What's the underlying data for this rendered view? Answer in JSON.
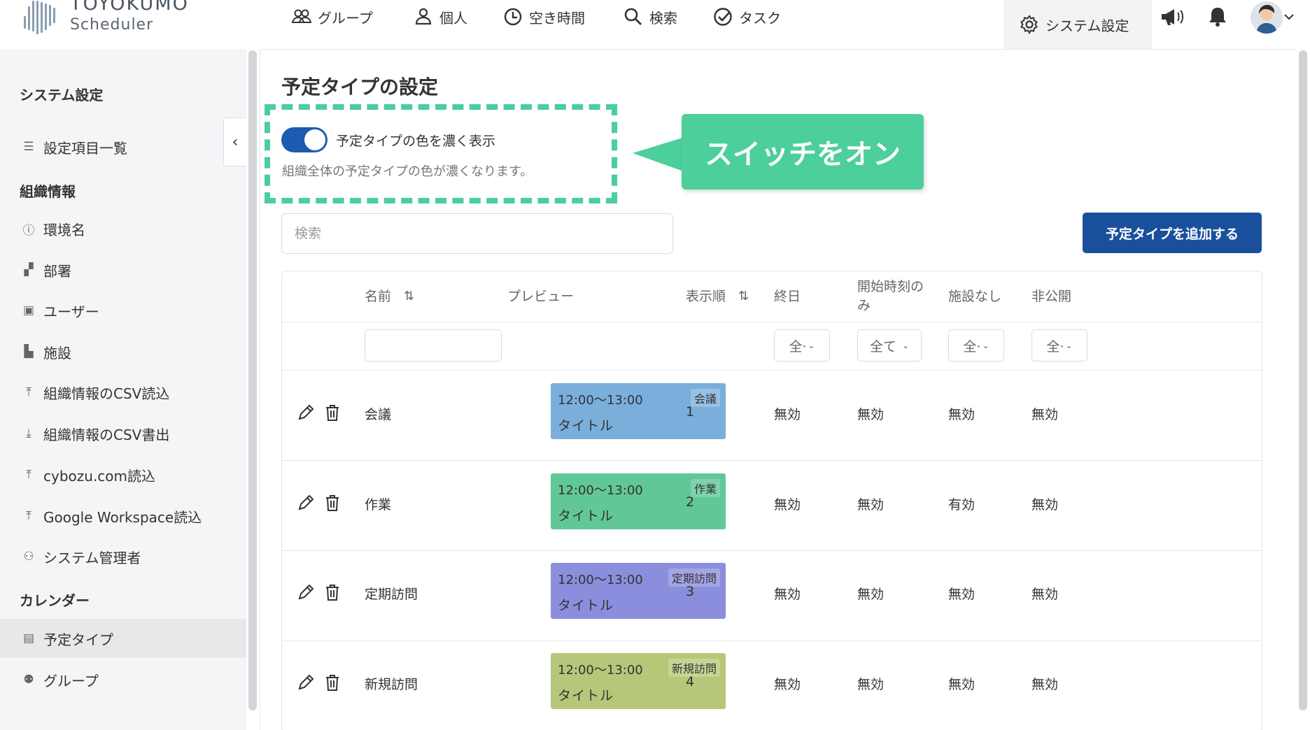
{
  "app": {
    "brand_title": "TOYOKUMO",
    "brand_sub": "Scheduler"
  },
  "nav": [
    {
      "label": "グループ",
      "icon": "group-icon"
    },
    {
      "label": "個人",
      "icon": "person-icon"
    },
    {
      "label": "空き時間",
      "icon": "clock-icon"
    },
    {
      "label": "検索",
      "icon": "search-icon"
    },
    {
      "label": "タスク",
      "icon": "task-check-icon"
    }
  ],
  "header": {
    "system_settings": "システム設定"
  },
  "sidebar": {
    "title": "システム設定",
    "items_top": [
      {
        "label": "設定項目一覧"
      }
    ],
    "section_org": "組織情報",
    "org_items": [
      {
        "label": "環境名"
      },
      {
        "label": "部署"
      },
      {
        "label": "ユーザー"
      },
      {
        "label": "施設"
      },
      {
        "label": "組織情報のCSV読込"
      },
      {
        "label": "組織情報のCSV書出"
      },
      {
        "label": "cybozu.com読込"
      },
      {
        "label": "Google Workspace読込"
      },
      {
        "label": "システム管理者"
      }
    ],
    "section_calendar": "カレンダー",
    "calendar_items": [
      {
        "label": "予定タイプ"
      },
      {
        "label": "グループ"
      }
    ]
  },
  "main": {
    "title": "予定タイプの設定",
    "toggle_label": "予定タイプの色を濃く表示",
    "toggle_on": true,
    "toggle_desc": "組織全体の予定タイプの色が濃くなります。",
    "callout": "スイッチをオン",
    "search_placeholder": "検索",
    "add_button": "予定タイプを追加する"
  },
  "table": {
    "headers": {
      "name": "名前",
      "preview": "プレビュー",
      "order": "表示順",
      "allday": "終日",
      "startonly_1": "開始時刻の",
      "startonly_2": "み",
      "nofacility": "施設なし",
      "private": "非公開",
      "sort_symbol": "⇅"
    },
    "filters": {
      "allday": "全·",
      "startonly": "全て",
      "nofacility": "全·",
      "private": "全·"
    },
    "rows": [
      {
        "name": "会議",
        "time": "12:00〜13:00",
        "ptitle": "タイトル",
        "tag": "会議",
        "color": "#7aaedb",
        "tagColor": "#98c0e4",
        "order": "1",
        "allday": "無効",
        "startonly": "無効",
        "nofacility": "無効",
        "private": "無効"
      },
      {
        "name": "作業",
        "time": "12:00〜13:00",
        "ptitle": "タイトル",
        "tag": "作業",
        "color": "#61c796",
        "tagColor": "#7fd3ab",
        "order": "2",
        "allday": "無効",
        "startonly": "無効",
        "nofacility": "有効",
        "private": "無効"
      },
      {
        "name": "定期訪問",
        "time": "12:00〜13:00",
        "ptitle": "タイトル",
        "tag": "定期訪問",
        "color": "#8a8edc",
        "tagColor": "#a3a6e4",
        "order": "3",
        "allday": "無効",
        "startonly": "無効",
        "nofacility": "無効",
        "private": "無効"
      },
      {
        "name": "新規訪問",
        "time": "12:00〜13:00",
        "ptitle": "タイトル",
        "tag": "新規訪問",
        "color": "#b6c77a",
        "tagColor": "#c6d594",
        "order": "4",
        "allday": "無効",
        "startonly": "無効",
        "nofacility": "無効",
        "private": "無効"
      }
    ]
  },
  "colors": {
    "accent": "#1a4f9c",
    "toggle": "#1d5bb0",
    "callout": "#4ccf9a"
  }
}
